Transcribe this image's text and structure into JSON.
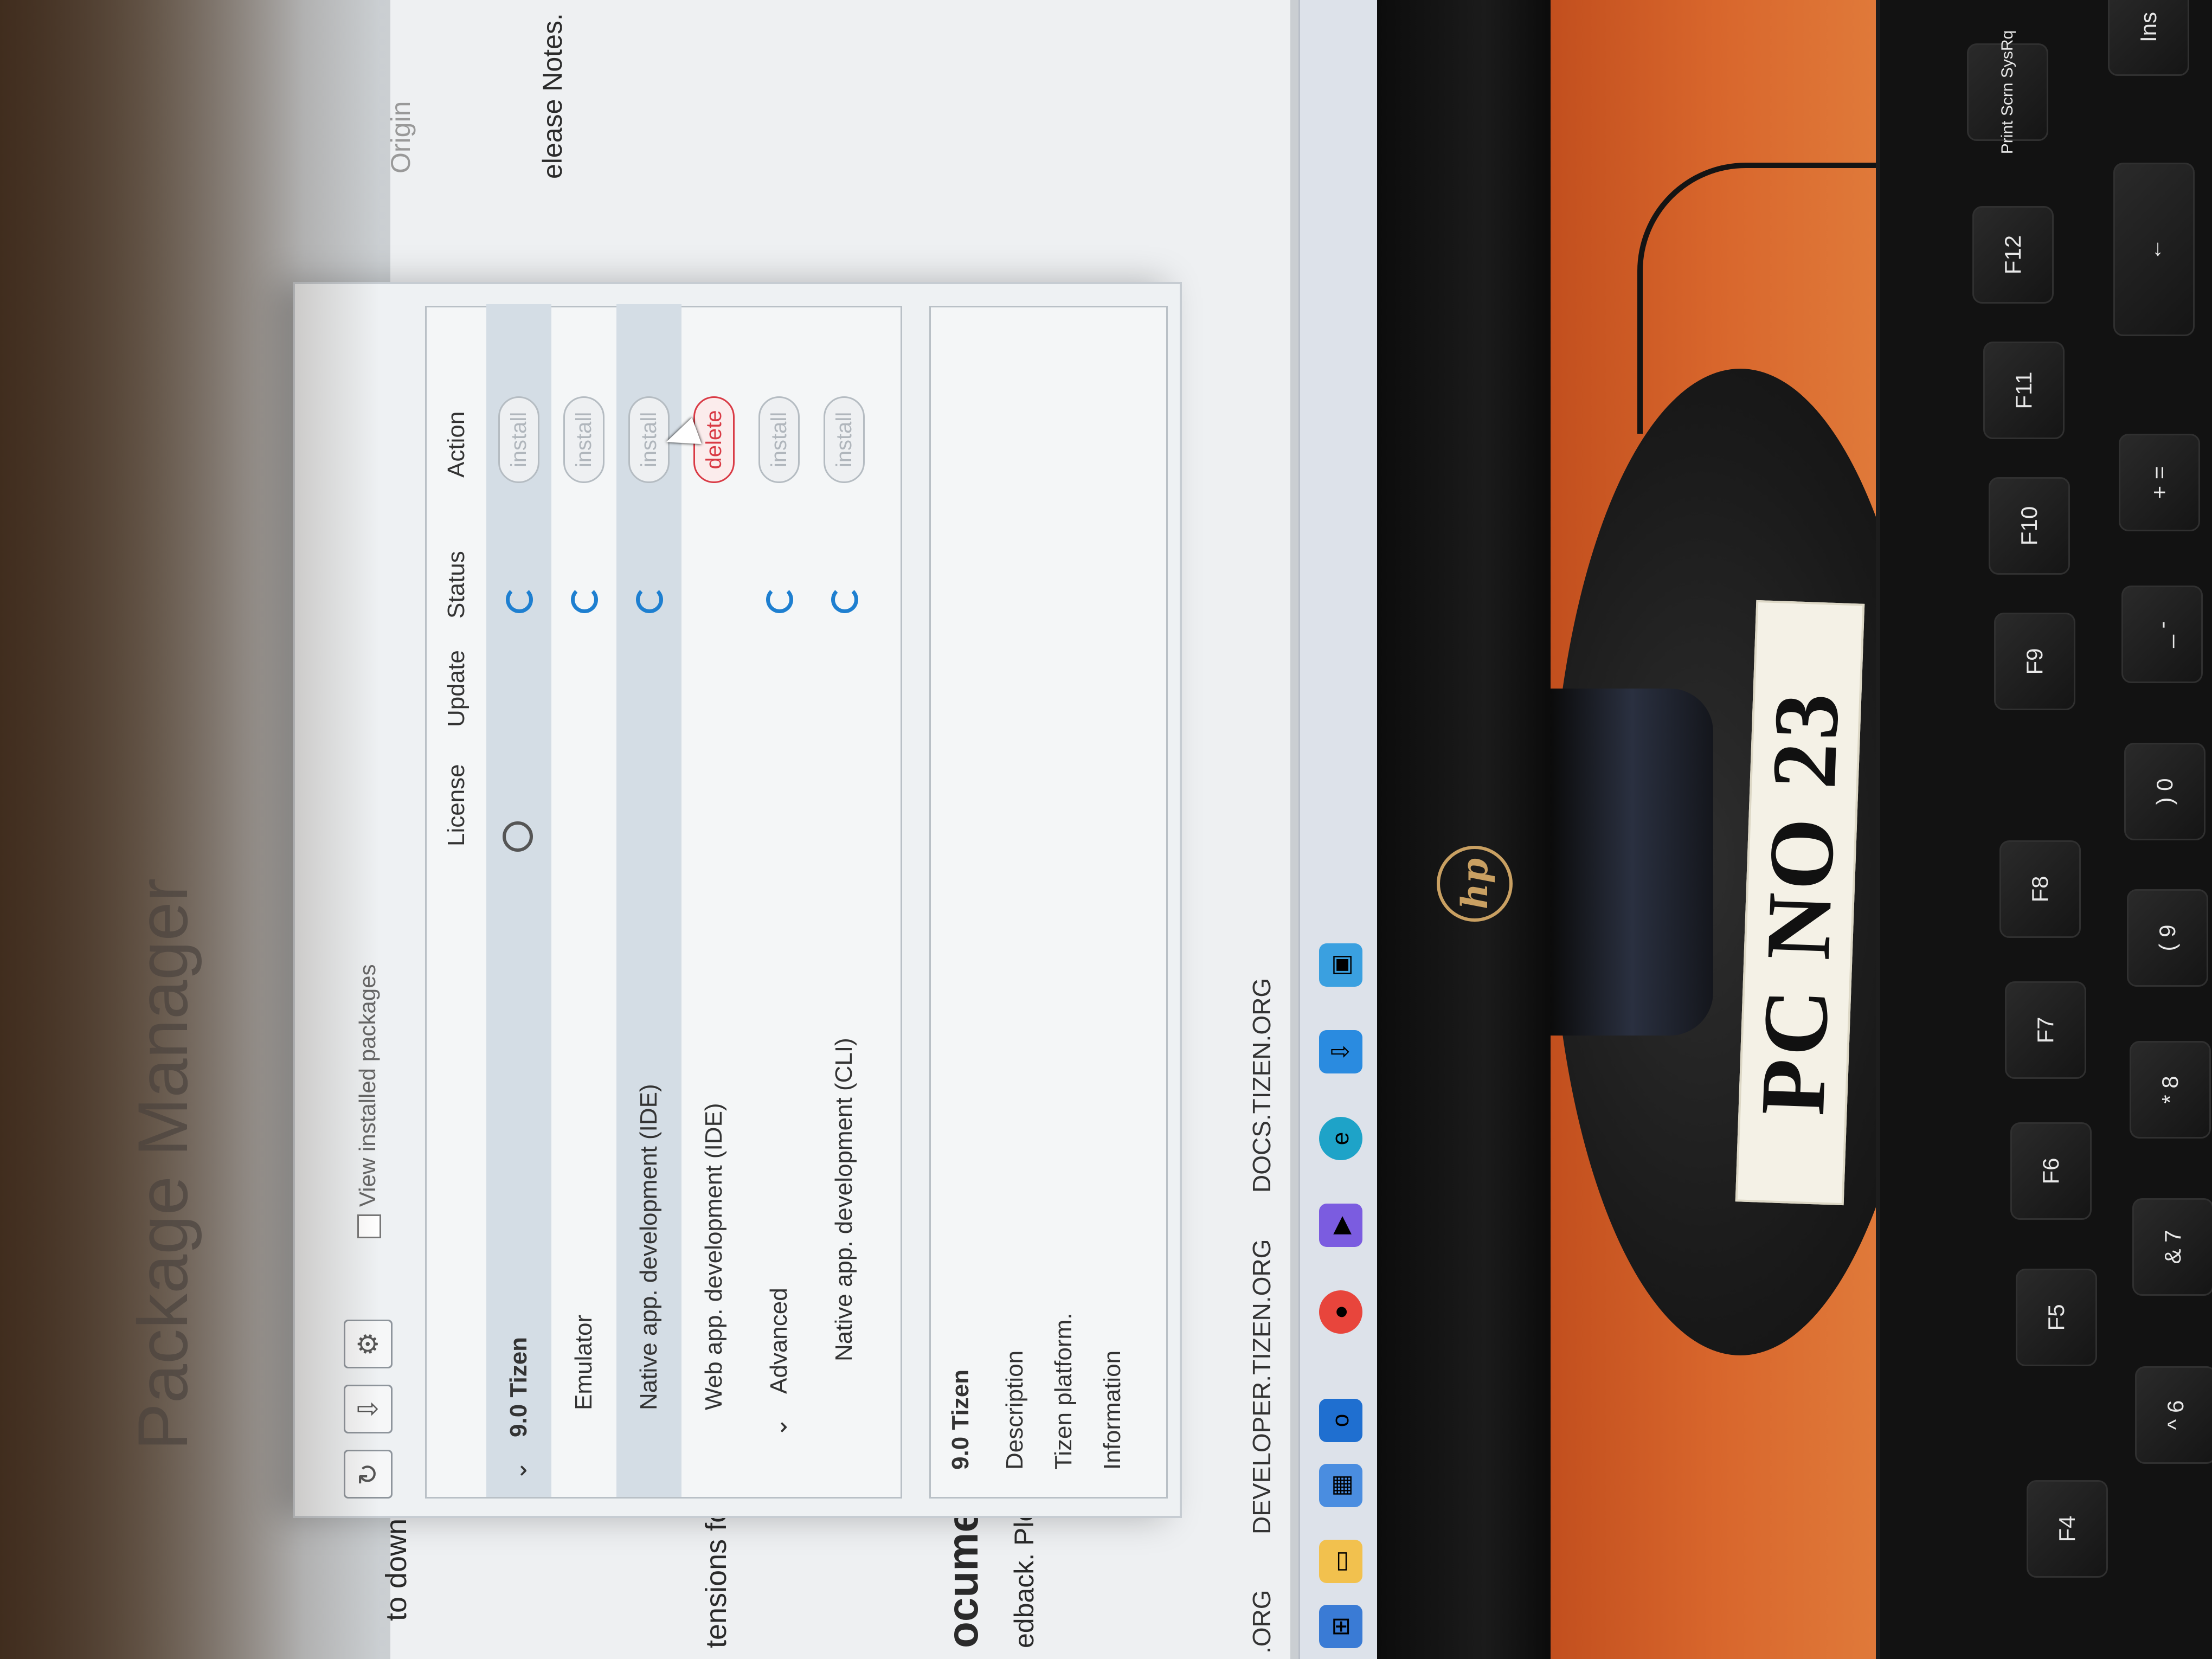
{
  "screen": {
    "app_title": "Package Manager",
    "view_installed_label": "View installed packages",
    "columns": {
      "license": "License",
      "update": "Update",
      "status": "Status",
      "action": "Action"
    },
    "packages": [
      {
        "name": "9.0 Tizen",
        "action": "install",
        "selected": true,
        "level": 0
      },
      {
        "name": "Emulator",
        "action": "install",
        "selected": false,
        "level": 1
      },
      {
        "name": "Native app. development (IDE)",
        "action": "install",
        "selected": true,
        "level": 1
      },
      {
        "name": "Web app. development (IDE)",
        "action": "delete",
        "selected": false,
        "level": 1
      },
      {
        "name": "Advanced",
        "action": "install",
        "selected": false,
        "level": 1
      },
      {
        "name": "Native app. development (CLI)",
        "action": "install",
        "selected": false,
        "level": 2
      }
    ],
    "details": {
      "title": "9.0 Tizen",
      "description_label": "Description",
      "description_text": "Tizen platform.",
      "information_label": "Information"
    },
    "background_page": {
      "release_notes": "elease Notes.",
      "to_down": "to down",
      "extensions": "tensions fo",
      "documen": "ocumen",
      "feedback": "edback. Please le",
      "origin": "Origin"
    },
    "footer_links": [
      "DEVELOPER.TIZEN.ORG",
      "DOCS.TIZEN.ORG",
      ".ORG"
    ],
    "taskbar_icons": [
      "windows-icon",
      "file-explorer-icon",
      "widgets-icon",
      "store-icon",
      "outlook-icon",
      "chrome-icon",
      "vlc-icon",
      "edge-icon",
      "download-icon",
      "app-icon"
    ]
  },
  "monitor": {
    "brand": "hp"
  },
  "desk_label": "PC NO 23",
  "keyboard": {
    "keys": [
      "Print Scrn SysRq",
      "F12",
      "F11",
      "F10",
      "F9",
      "F8",
      "F7",
      "F6",
      "F5",
      "F4",
      "Ins",
      "←",
      "+ =",
      "_ -",
      ") 0",
      "( 9",
      "* 8",
      "& 7",
      "^ 6"
    ]
  },
  "colors": {
    "accent": "#1f9ad6",
    "delete": "#d93a45",
    "status": "#1e7fd0",
    "label_bg": "#f4f1e6"
  }
}
